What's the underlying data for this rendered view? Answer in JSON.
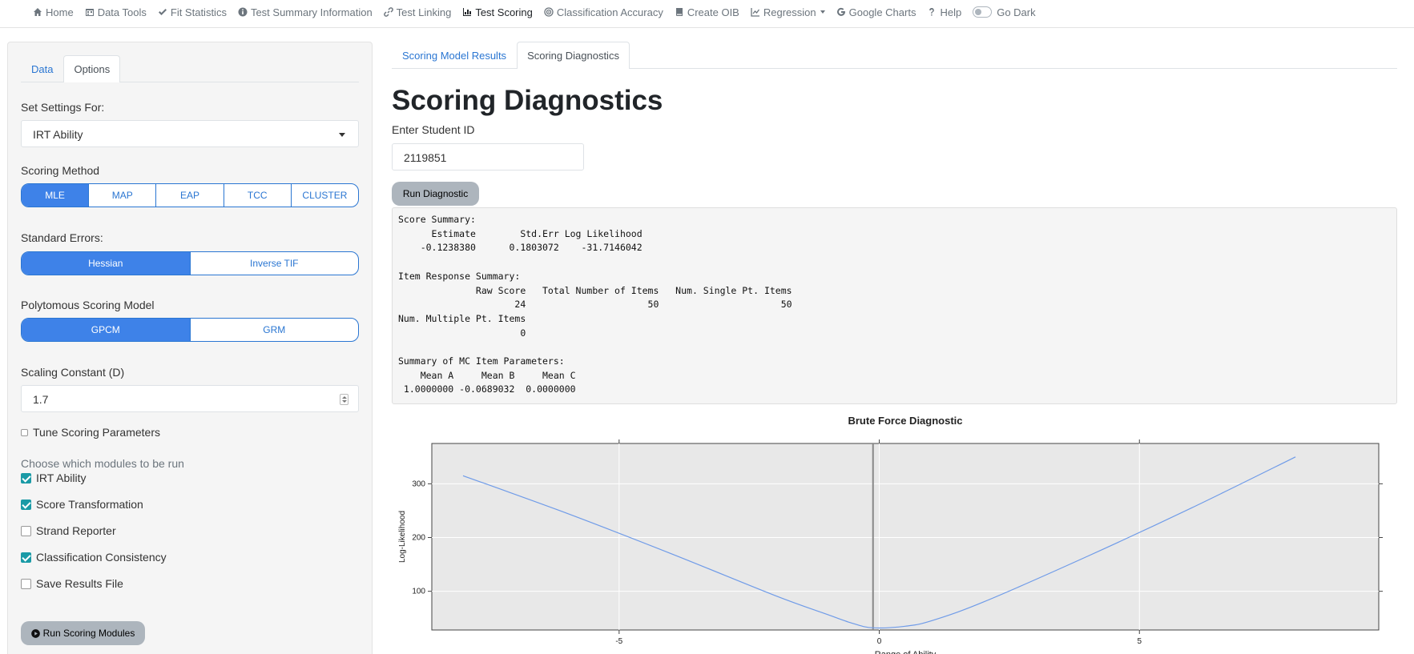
{
  "nav": {
    "items": [
      {
        "label": "Home",
        "icon": "home-icon"
      },
      {
        "label": "Data Tools",
        "icon": "calendar-icon"
      },
      {
        "label": "Fit Statistics",
        "icon": "check-icon"
      },
      {
        "label": "Test Summary Information",
        "icon": "info-circle-icon"
      },
      {
        "label": "Test Linking",
        "icon": "link-icon"
      },
      {
        "label": "Test Scoring",
        "icon": "bar-chart-icon"
      },
      {
        "label": "Classification Accuracy",
        "icon": "bullseye-icon"
      },
      {
        "label": "Create OIB",
        "icon": "book-icon"
      },
      {
        "label": "Regression",
        "icon": "line-chart-icon"
      },
      {
        "label": "Google Charts",
        "icon": "google-icon"
      },
      {
        "label": "Help",
        "icon": "question-icon"
      }
    ],
    "dark_toggle_label": "Go Dark"
  },
  "sidebar": {
    "tabs": [
      "Data",
      "Options"
    ],
    "active_tab": "Options",
    "set_settings_label": "Set Settings For:",
    "set_settings_value": "IRT Ability",
    "scoring_method_label": "Scoring Method",
    "scoring_methods": [
      "MLE",
      "MAP",
      "EAP",
      "TCC",
      "CLUSTER"
    ],
    "scoring_method_selected": "MLE",
    "std_errors_label": "Standard Errors:",
    "std_errors": [
      "Hessian",
      "Inverse TIF"
    ],
    "std_errors_selected": "Hessian",
    "poly_label": "Polytomous Scoring Model",
    "poly_models": [
      "GPCM",
      "GRM"
    ],
    "poly_selected": "GPCM",
    "scaling_label": "Scaling Constant (D)",
    "scaling_value": "1.7",
    "tune_label": "Tune Scoring Parameters",
    "modules_label": "Choose which modules to be run",
    "modules": [
      {
        "label": "IRT Ability",
        "checked": true
      },
      {
        "label": "Score Transformation",
        "checked": true
      },
      {
        "label": "Strand Reporter",
        "checked": false
      },
      {
        "label": "Classification Consistency",
        "checked": true
      },
      {
        "label": "Save Results File",
        "checked": false
      }
    ],
    "run_modules_label": "Run Scoring Modules"
  },
  "main": {
    "tabs": [
      "Scoring Model Results",
      "Scoring Diagnostics"
    ],
    "active_tab": "Scoring Diagnostics",
    "title": "Scoring Diagnostics",
    "student_id_label": "Enter Student ID",
    "student_id_value": "2119851",
    "run_diag_label": "Run Diagnostic",
    "output_text": "Score Summary:\n      Estimate        Std.Err Log Likelihood\n    -0.1238380      0.1803072    -31.7146042\n\nItem Response Summary:\n              Raw Score   Total Number of Items   Num. Single Pt. Items\n                     24                      50                      50\nNum. Multiple Pt. Items\n                      0\n\nSummary of MC Item Parameters:\n    Mean A     Mean B     Mean C\n 1.0000000 -0.0689032  0.0000000"
  },
  "colors": {
    "accent": "#3e82e8",
    "link": "#2a76d2",
    "checkbox": "#1a9aa6",
    "plot_bg": "#e8e8e8",
    "line": "#6f9be8"
  },
  "chart_data": {
    "type": "line",
    "title": "Brute Force Diagnostic",
    "xlabel": "Range of Ability",
    "ylabel": "Log-Likelihood",
    "xlim": [
      -8.6,
      9.6
    ],
    "ylim": [
      28,
      375
    ],
    "xticks": [
      -5,
      0,
      5
    ],
    "yticks": [
      100,
      200,
      300
    ],
    "x": [
      -8,
      -6,
      -4,
      -2,
      -1,
      -0.5,
      -0.12,
      0.5,
      1,
      2,
      4,
      6,
      8
    ],
    "y": [
      315,
      245,
      170,
      92,
      57,
      40,
      32,
      35,
      45,
      80,
      165,
      255,
      350
    ],
    "vline_x": -0.12,
    "grid": true
  }
}
